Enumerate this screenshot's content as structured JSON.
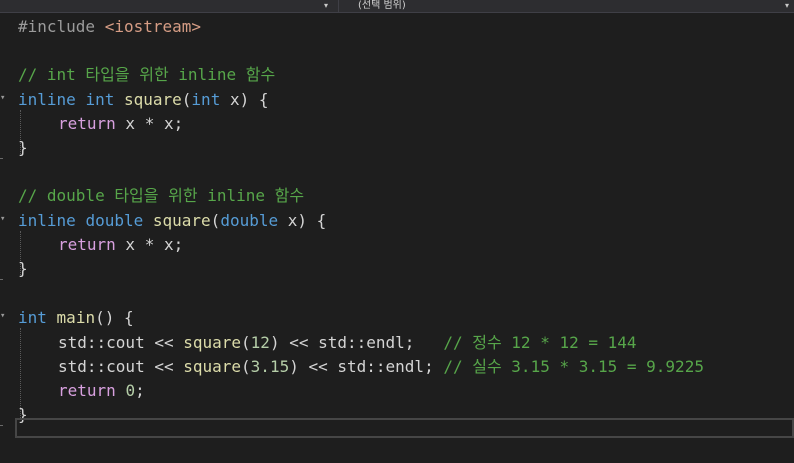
{
  "toolbar": {
    "scope_dropdown_value": "",
    "member_dropdown_value": "(선택 범위)"
  },
  "code": {
    "l1": [
      "#include ",
      "<iostream>"
    ],
    "l3": "// int 타입을 위한 inline 함수",
    "l4": [
      "inline",
      " ",
      "int",
      " ",
      "square",
      "(",
      "int",
      " x) {"
    ],
    "l5": [
      "return",
      " x * x;"
    ],
    "l6": "}",
    "l8": "// double 타입을 위한 inline 함수",
    "l9": [
      "inline",
      " ",
      "double",
      " ",
      "square",
      "(",
      "double",
      " x) {"
    ],
    "l10": [
      "return",
      " x * x;"
    ],
    "l11": "}",
    "l13": [
      "int",
      " ",
      "main",
      "() {"
    ],
    "l14": [
      "std::cout << ",
      "square",
      "(",
      "12",
      ") << std::endl;   ",
      "// 정수 12 * 12 = 144"
    ],
    "l15": [
      "std::cout << ",
      "square",
      "(",
      "3.15",
      ") << std::endl; ",
      "// 실수 3.15 * 3.15 = 9.9225"
    ],
    "l16": [
      "return",
      " ",
      "0",
      ";"
    ],
    "l17": "}"
  },
  "icons": {
    "collapse": "chevron-down-icon",
    "dropdown": "triangle-down-icon"
  }
}
